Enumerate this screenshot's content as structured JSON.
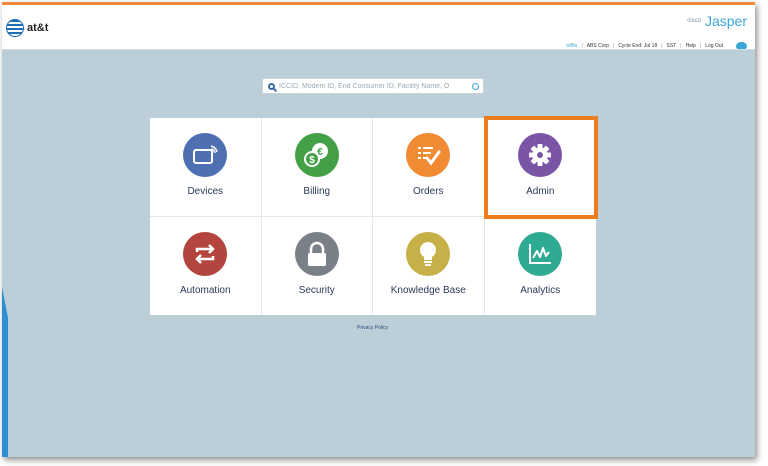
{
  "header": {
    "logo_text": "at&t",
    "brand_small": "cisco",
    "brand_name": "Jasper"
  },
  "usernav": {
    "username": "inBlu",
    "account": "ABS Corp",
    "cycle": "Cycle End: Jul 18",
    "timezone": "SST",
    "help": "Help",
    "logout": "Log Out"
  },
  "search": {
    "placeholder": "ICCID, Modem ID, End Consumer ID, Facility Name, O"
  },
  "tiles": [
    {
      "label": "Devices",
      "color": "#4f6fb3",
      "icon": "device-card-icon"
    },
    {
      "label": "Billing",
      "color": "#43a046",
      "icon": "billing-coins-icon"
    },
    {
      "label": "Orders",
      "color": "#f08a33",
      "icon": "orders-checklist-icon"
    },
    {
      "label": "Admin",
      "color": "#7a55a6",
      "icon": "gear-icon"
    },
    {
      "label": "Automation",
      "color": "#b3453e",
      "icon": "automation-arrows-icon"
    },
    {
      "label": "Security",
      "color": "#7a8088",
      "icon": "lock-icon"
    },
    {
      "label": "Knowledge Base",
      "color": "#c8b048",
      "icon": "lightbulb-icon"
    },
    {
      "label": "Analytics",
      "color": "#2faa92",
      "icon": "analytics-chart-icon"
    }
  ],
  "footer": {
    "privacy": "Privacy Policy"
  }
}
